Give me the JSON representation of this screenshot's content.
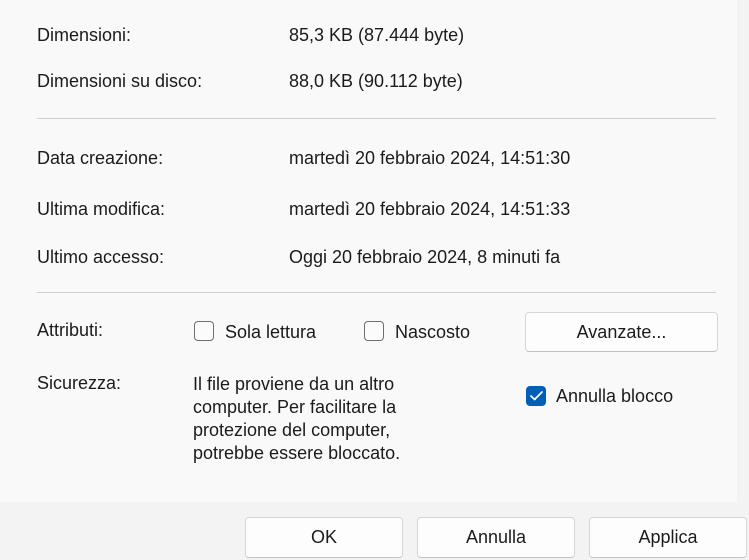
{
  "details": {
    "size_label": "Dimensioni:",
    "size_value": "85,3 KB (87.444 byte)",
    "disk_label": "Dimensioni su disco:",
    "disk_value": "88,0 KB (90.112 byte)",
    "created_label": "Data creazione:",
    "created_value": "martedì 20 febbraio 2024, 14:51:30",
    "modified_label": "Ultima modifica:",
    "modified_value": "martedì 20 febbraio 2024, 14:51:33",
    "accessed_label": "Ultimo accesso:",
    "accessed_value": "Oggi 20 febbraio 2024, 8 minuti fa"
  },
  "attributes": {
    "label": "Attributi:",
    "readonly_label": "Sola lettura",
    "readonly_checked": false,
    "hidden_label": "Nascosto",
    "hidden_checked": false,
    "advanced_button": "Avanzate..."
  },
  "security": {
    "label": "Sicurezza:",
    "message_lines": [
      "Il file proviene da un altro",
      "computer. Per facilitare la",
      "protezione del computer,",
      "potrebbe essere bloccato."
    ],
    "unblock_label": "Annulla blocco",
    "unblock_checked": true
  },
  "footer": {
    "ok_label": "OK",
    "cancel_label": "Annulla",
    "apply_label": "Applica"
  },
  "colors": {
    "accent": "#005fb8"
  }
}
